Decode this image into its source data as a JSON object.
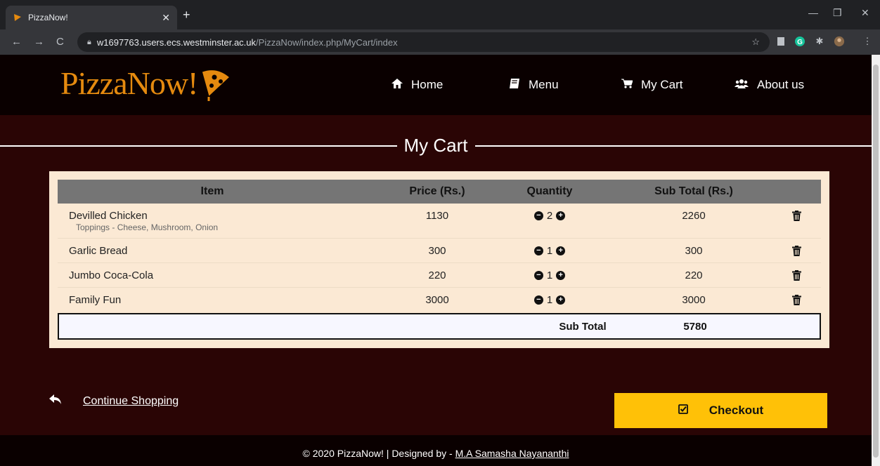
{
  "browser": {
    "tab_title": "PizzaNow!",
    "url_host": "w1697763.users.ecs.westminster.ac.uk",
    "url_path": "/PizzaNow/index.php/MyCart/index"
  },
  "site": {
    "logo_text": "PizzaNow!",
    "brand_color": "#e58a0f",
    "nav": {
      "home": "Home",
      "menu": "Menu",
      "cart": "My Cart",
      "about": "About us"
    }
  },
  "cart": {
    "title": "My Cart",
    "columns": {
      "item": "Item",
      "price": "Price (Rs.)",
      "quantity": "Quantity",
      "subtotal": "Sub Total (Rs.)"
    },
    "rows": [
      {
        "name": "Devilled Chicken",
        "toppings": "Toppings - Cheese, Mushroom, Onion",
        "price": "1130",
        "qty": "2",
        "subtotal": "2260"
      },
      {
        "name": "Garlic Bread",
        "toppings": "",
        "price": "300",
        "qty": "1",
        "subtotal": "300"
      },
      {
        "name": "Jumbo Coca-Cola",
        "toppings": "",
        "price": "220",
        "qty": "1",
        "subtotal": "220"
      },
      {
        "name": "Family Fun",
        "toppings": "",
        "price": "3000",
        "qty": "1",
        "subtotal": "3000"
      }
    ],
    "subtotal_label": "Sub Total",
    "subtotal_value": "5780"
  },
  "actions": {
    "continue_label": "Continue Shopping",
    "checkout_label": "Checkout",
    "checkout_color": "#ffc107"
  },
  "footer": {
    "text": "© 2020 PizzaNow! | Designed by - ",
    "author": "M.A Samasha Nayananthi"
  }
}
